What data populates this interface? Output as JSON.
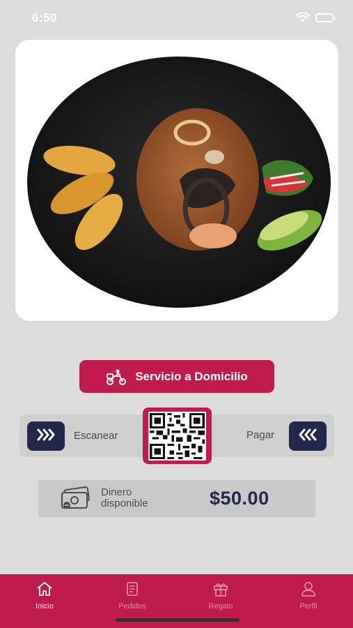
{
  "status_bar": {
    "time": "6:50"
  },
  "hero": {
    "image_alt": "Plato de arroz con mariscos, patacones y ensalada",
    "carousel_active_index": 0,
    "carousel_count": 1
  },
  "delivery": {
    "label": "Servicio a Domicilio"
  },
  "scan_pay": {
    "scan_label": "Escanear",
    "pay_label": "Pagar"
  },
  "balance": {
    "label_line1": "Dinero",
    "label_line2": "disponible",
    "amount": "$50.00"
  },
  "tabs": [
    {
      "label": "Inicio",
      "icon": "home-icon",
      "active": true
    },
    {
      "label": "Pedidos",
      "icon": "orders-icon",
      "active": false
    },
    {
      "label": "Regalo",
      "icon": "gift-icon",
      "active": false
    },
    {
      "label": "Perfil",
      "icon": "profile-icon",
      "active": false
    }
  ],
  "colors": {
    "primary": "#c01b4d",
    "navy": "#23274a",
    "background": "#dcdcdc"
  }
}
